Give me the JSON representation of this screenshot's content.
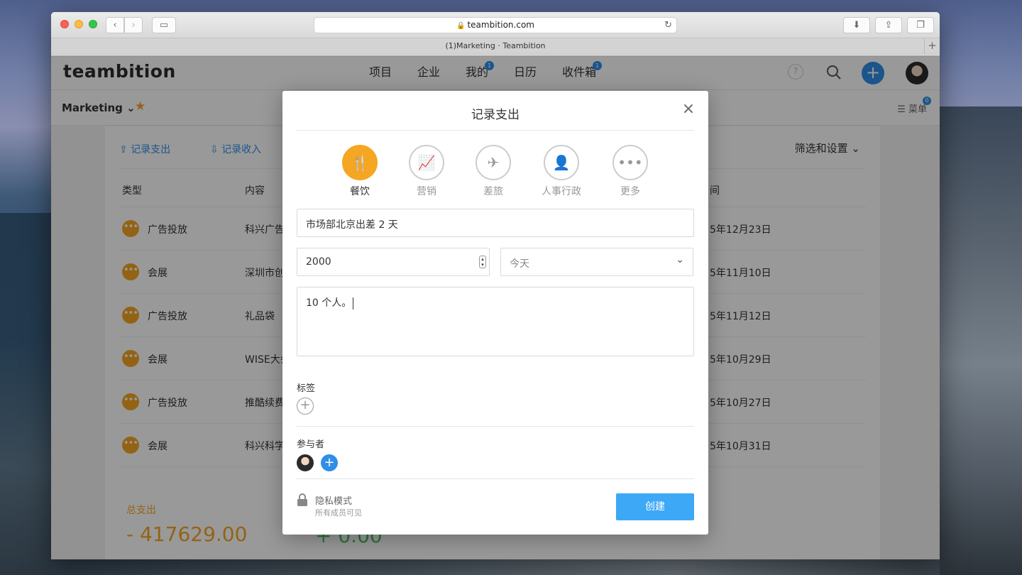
{
  "browser": {
    "url": "teambition.com",
    "tab_title": "(1)Marketing · Teambition"
  },
  "app": {
    "logo": "teambition",
    "nav": [
      {
        "label": "项目",
        "badge": ""
      },
      {
        "label": "企业",
        "badge": ""
      },
      {
        "label": "我的",
        "badge": "1"
      },
      {
        "label": "日历",
        "badge": ""
      },
      {
        "label": "收件箱",
        "badge": "1"
      }
    ],
    "help": "?",
    "add": "+"
  },
  "project": {
    "name": "Marketing",
    "menu_label": "菜单",
    "menu_badge": "0"
  },
  "ledger": {
    "record_expense": "记录支出",
    "record_income": "记录收入",
    "filter_settings": "筛选和设置",
    "headers": {
      "type": "类型",
      "content": "内容",
      "date": "间"
    },
    "rows": [
      {
        "type": "广告投放",
        "content": "科兴广告",
        "date": "5年12月23日"
      },
      {
        "type": "会展",
        "content": "深圳市创",
        "date": "5年11月10日"
      },
      {
        "type": "广告投放",
        "content": "礼品袋",
        "date": "5年11月12日"
      },
      {
        "type": "会展",
        "content": "WISE大会",
        "date": "5年10月29日"
      },
      {
        "type": "广告投放",
        "content": "推酷续费",
        "date": "5年10月27日"
      },
      {
        "type": "会展",
        "content": "科兴科学",
        "date": "5年10月31日"
      }
    ],
    "total_label": "总支出",
    "total_value": "- 417629.00",
    "income_value": "+ 0.00"
  },
  "modal": {
    "title": "记录支出",
    "close": "×",
    "categories": [
      {
        "label": "餐饮",
        "icon": "fork-knife-icon",
        "active": true
      },
      {
        "label": "营销",
        "icon": "chart-icon",
        "active": false
      },
      {
        "label": "差旅",
        "icon": "airplane-icon",
        "active": false
      },
      {
        "label": "人事行政",
        "icon": "person-icon",
        "active": false
      },
      {
        "label": "更多",
        "icon": "more-icon",
        "active": false
      }
    ],
    "title_value": "市场部北京出差 2 天",
    "amount_value": "2000",
    "date_value": "今天",
    "note_value": "10 个人。",
    "tags_label": "标签",
    "participants_label": "参与者",
    "privacy_title": "隐私模式",
    "privacy_sub": "所有成员可见",
    "create_label": "创建"
  },
  "colors": {
    "accent": "#3da8f5",
    "brand_blue": "#2f8ee8",
    "category_active": "#f5a623"
  }
}
